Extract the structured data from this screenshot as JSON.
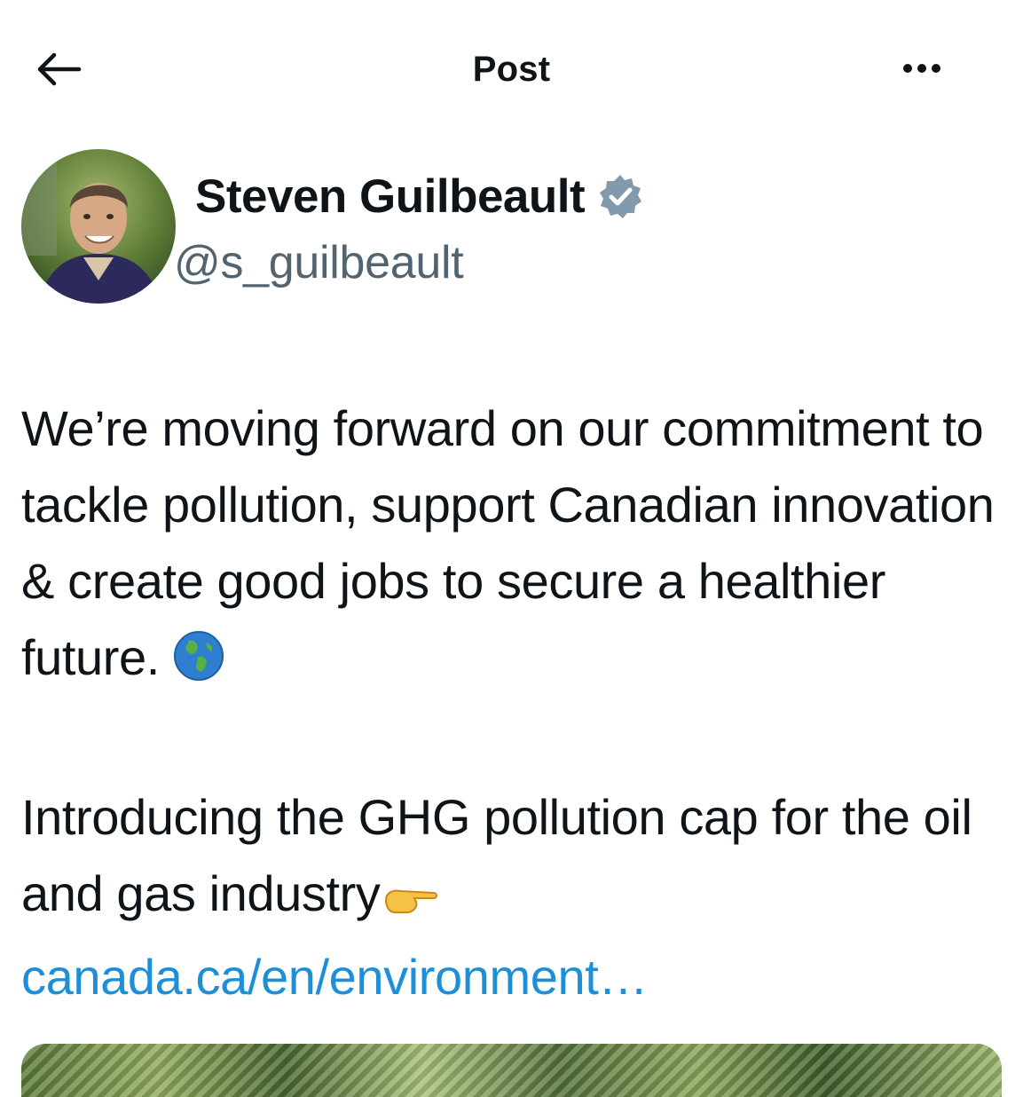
{
  "header": {
    "title": "Post",
    "back_icon": "arrow-left-icon",
    "more_icon": "more-horizontal-icon"
  },
  "author": {
    "name": "Steven Guilbeault",
    "handle": "@s_guilbeault",
    "verified_icon": "verified-badge-icon",
    "badge_color": "#829aab"
  },
  "post": {
    "paragraph1": "We’re moving forward on our commitment to tackle pollution, support Canadian innovation & create good jobs to secure a healthier future.",
    "paragraph1_emoji": "🌎",
    "paragraph2_text": "Introducing the GHG pollution cap for the oil and gas industry",
    "paragraph2_emoji": "👉",
    "link_text": "canada.ca/en/environment…",
    "link_color": "#1d8fd8"
  },
  "colors": {
    "text": "#0f1419",
    "secondary_text": "#536471",
    "background": "#ffffff"
  }
}
